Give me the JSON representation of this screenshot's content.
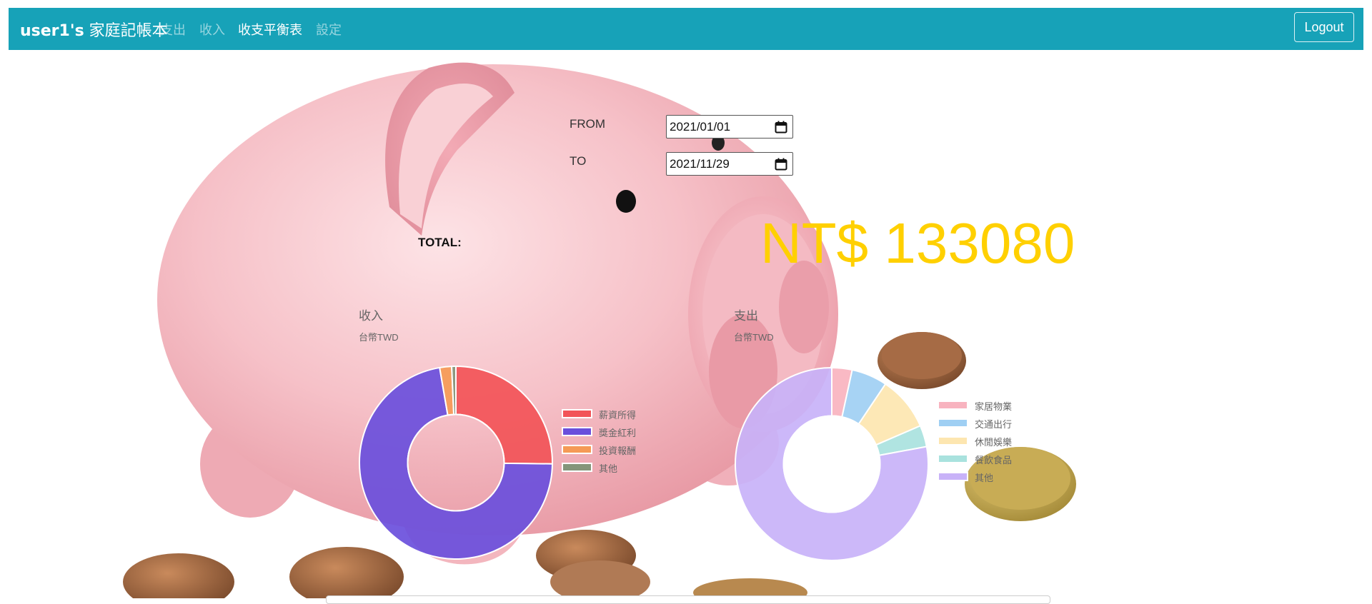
{
  "navbar": {
    "brand_user": "user1's",
    "brand_title": "家庭記帳本",
    "links": [
      "支出",
      "收入",
      "收支平衡表",
      "設定"
    ],
    "active_link": "收支平衡表",
    "logout_label": "Logout"
  },
  "filter": {
    "from_label": "FROM",
    "from_value": "2021/01/01",
    "to_label": "TO",
    "to_value": "2021/11/29"
  },
  "total": {
    "label": "TOTAL:",
    "value": "NT$ 133080",
    "color": "#ffd000"
  },
  "charts": {
    "income": {
      "title": "收入",
      "subtitle": "台幣TWD"
    },
    "expense": {
      "title": "支出",
      "subtitle": "台幣TWD"
    }
  },
  "chart_data": [
    {
      "type": "pie",
      "title": "收入",
      "subtitle": "台幣TWD",
      "categories": [
        "薪資所得",
        "獎金紅利",
        "投資報酬",
        "其他"
      ],
      "values": [
        25.2,
        72.1,
        2.0,
        0.7
      ],
      "colors": [
        "#f25458",
        "#6a4fdc",
        "#f59a56",
        "#85957a"
      ],
      "hole": 0.5,
      "legend": "right"
    },
    {
      "type": "pie",
      "title": "支出",
      "subtitle": "台幣TWD",
      "categories": [
        "家居物業",
        "交通出行",
        "休閒娛樂",
        "餐飲食品",
        "其他"
      ],
      "values": [
        3.4,
        6.0,
        9.1,
        3.6,
        77.9
      ],
      "colors": [
        "#f8b3bf",
        "#9fcff3",
        "#fde6b0",
        "#a9e2de",
        "#c8b2f8"
      ],
      "hole": 0.5,
      "legend": "right"
    }
  ],
  "colors": {
    "navbar": "#17a2b8",
    "total": "#ffd000"
  }
}
